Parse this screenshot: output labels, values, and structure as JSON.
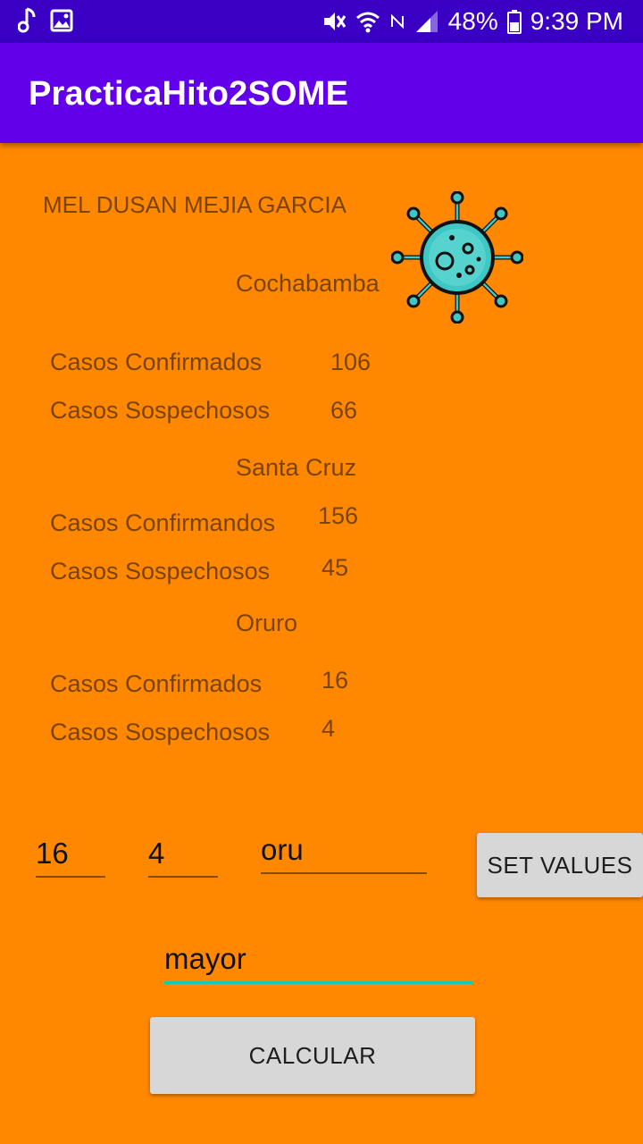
{
  "status_bar": {
    "battery": "48%",
    "time": "9:39 PM"
  },
  "app_bar": {
    "title": "PracticaHito2SOME"
  },
  "header": {
    "author": "MEL DUSAN MEJIA GARCIA"
  },
  "sections": [
    {
      "city": "Cochabamba",
      "confirmed_label": "Casos Confirmados",
      "confirmed_value": "106",
      "suspected_label": "Casos Sospechosos",
      "suspected_value": "66"
    },
    {
      "city": "Santa Cruz",
      "confirmed_label": "Casos Confirmandos",
      "confirmed_value": "156",
      "suspected_label": "Casos Sospechosos",
      "suspected_value": "45"
    },
    {
      "city": "Oruro",
      "confirmed_label": "Casos Confirmados",
      "confirmed_value": "16",
      "suspected_label": "Casos Sospechosos",
      "suspected_value": "4"
    }
  ],
  "inputs": {
    "confirmed": "16",
    "suspected": "4",
    "city_code": "oru",
    "mode": "mayor"
  },
  "buttons": {
    "set_values": "SET VALUES",
    "calcular": "CALCULAR"
  },
  "icons": {
    "virus": "virus-icon",
    "virus_color": "#3EC7C4"
  }
}
